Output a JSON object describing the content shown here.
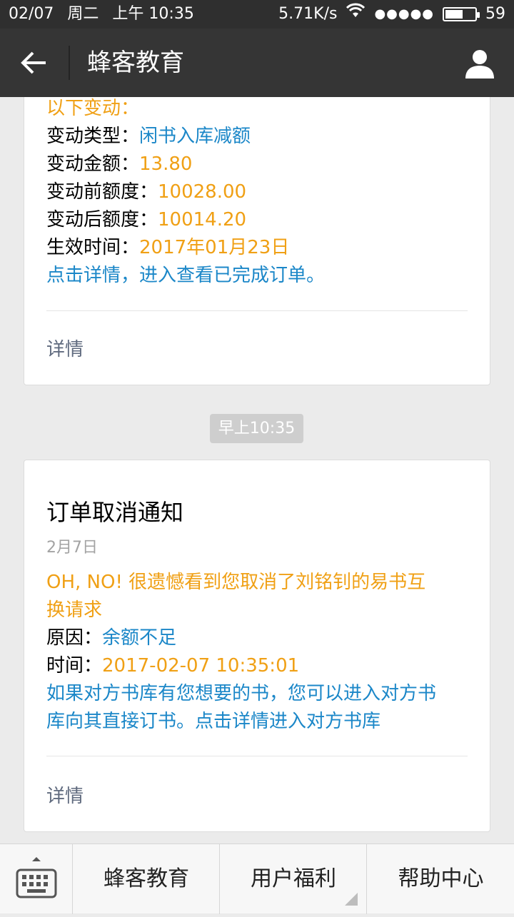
{
  "status_bar": {
    "date": "02/07",
    "weekday": "周二",
    "time": "上午 10:35",
    "network_speed": "5.71K/s",
    "signal": "●●●●●",
    "battery_level": "59",
    "battery_fraction": 0.59
  },
  "header": {
    "title": "蜂客教育",
    "back_icon": "arrow-left-icon",
    "profile_icon": "person-icon"
  },
  "card1": {
    "intro": "以下变动：",
    "rows": [
      {
        "label": "变动类型：",
        "value": "闲书入库减额"
      },
      {
        "label": "变动金额：",
        "value": "13.80"
      },
      {
        "label": "变动前额度：",
        "value": "10028.00"
      },
      {
        "label": "变动后额度：",
        "value": "10014.20"
      },
      {
        "label": "生效时间：",
        "value": "2017年01月23日"
      }
    ],
    "note": "点击详情，进入查看已完成订单。",
    "details_link": "详情"
  },
  "time_tag": "早上10:35",
  "card2": {
    "title": "订单取消通知",
    "date": "2月7日",
    "message_line1": "OH, NO! 很遗憾看到您取消了刘铭钊的易书互",
    "message_line2": "换请求",
    "reason_label": "原因：",
    "reason_value": "余额不足",
    "time_label": "时间：",
    "time_value": "2017-02-07 10:35:01",
    "note_line1": "如果对方书库有您想要的书，您可以进入对方书",
    "note_line2": "库向其直接订书。点击详情进入对方书库",
    "details_link": "详情"
  },
  "bottom_menu": {
    "keyboard_icon": "keyboard-icon",
    "items": [
      "蜂客教育",
      "用户福利",
      "帮助中心"
    ]
  },
  "colors": {
    "orange": "#f0a015",
    "blue": "#1b87c8",
    "header_bg": "#353535"
  }
}
